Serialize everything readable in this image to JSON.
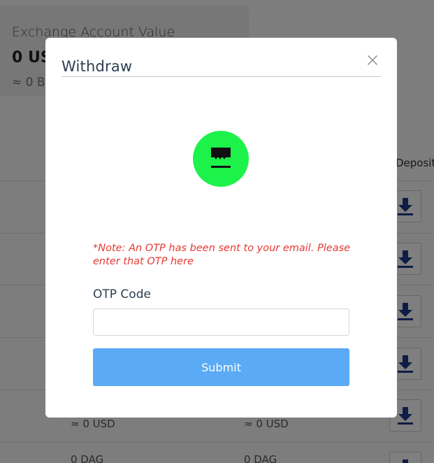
{
  "background": {
    "account_card": {
      "title": "Exchange Account Value",
      "value": "0 US",
      "btc_value": "≈ 0 B"
    },
    "table": {
      "deposit_header": "Deposit",
      "rows": [
        {
          "col1": "≈ 0 USD",
          "col2": "≈ 0 USD"
        },
        {
          "col1": "0 DAG",
          "col2": "0 DAG"
        }
      ]
    }
  },
  "modal": {
    "title": "Withdraw",
    "note": "*Note: An OTP has been sent to your email. Please enter that OTP here",
    "otp_label": "OTP Code",
    "otp_value": "",
    "otp_placeholder": "",
    "submit_label": "Submit"
  },
  "colors": {
    "icon_bg": "#1cf24a",
    "note_red": "#e53935",
    "submit_blue": "#5aaaf5"
  },
  "icons": {
    "close": "close-icon",
    "otp": "otp-message-icon",
    "deposit": "download-icon"
  }
}
